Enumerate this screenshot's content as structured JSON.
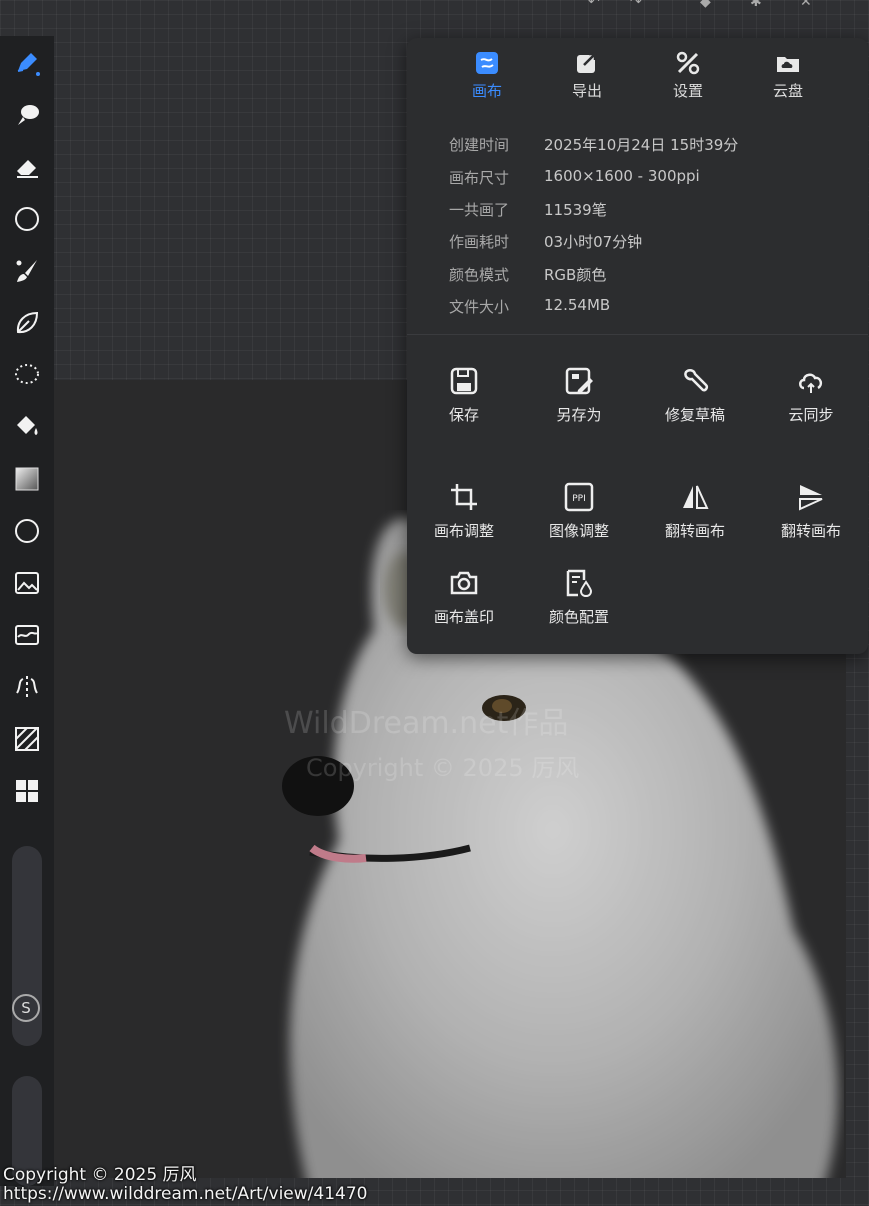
{
  "panel": {
    "tabs": [
      {
        "label": "画布",
        "icon": "canvas-icon",
        "active": true
      },
      {
        "label": "导出",
        "icon": "export-icon",
        "active": false
      },
      {
        "label": "设置",
        "icon": "settings-icon",
        "active": false
      },
      {
        "label": "云盘",
        "icon": "cloud-drive-icon",
        "active": false
      }
    ],
    "info": [
      {
        "key": "创建时间",
        "value": "2025年10月24日 15时39分"
      },
      {
        "key": "画布尺寸",
        "value": "1600×1600 - 300ppi"
      },
      {
        "key": "一共画了",
        "value": "11539笔"
      },
      {
        "key": "作画耗时",
        "value": "03小时07分钟"
      },
      {
        "key": "颜色模式",
        "value": "RGB颜色"
      },
      {
        "key": "文件大小",
        "value": "12.54MB"
      }
    ],
    "actions": [
      {
        "label": "保存",
        "icon": "save-icon"
      },
      {
        "label": "另存为",
        "icon": "save-as-icon"
      },
      {
        "label": "修复草稿",
        "icon": "repair-icon"
      },
      {
        "label": "云同步",
        "icon": "cloud-sync-icon"
      },
      {
        "label": "画布调整",
        "icon": "crop-icon"
      },
      {
        "label": "图像调整",
        "icon": "ppi-icon"
      },
      {
        "label": "翻转画布",
        "icon": "flip-horizontal-icon"
      },
      {
        "label": "翻转画布",
        "icon": "flip-vertical-icon"
      },
      {
        "label": "画布盖印",
        "icon": "camera-icon"
      },
      {
        "label": "颜色配置",
        "icon": "color-profile-icon"
      }
    ]
  },
  "toolbar": {
    "tools": [
      "pen-icon",
      "smudge-icon",
      "eraser-icon",
      "circle-icon",
      "brush-icon",
      "leaf-icon",
      "lasso-icon",
      "fill-icon",
      "gradient-icon",
      "shape-circle-icon",
      "image-icon",
      "filter-icon",
      "symmetry-icon",
      "texture-icon",
      "layers-grid-icon"
    ],
    "s_button": "S"
  },
  "canvas": {
    "watermark": "WildDream.net作品",
    "watermark_copyright": "Copyright © 2025 厉风"
  },
  "footer": {
    "copyright": "Copyright © 2025 厉风",
    "url": "https://www.wilddream.net/Art/view/41470"
  },
  "colors": {
    "accent": "#3b8cff",
    "panel_bg": "#2c2d2f",
    "toolbar_bg": "#1f2022"
  }
}
